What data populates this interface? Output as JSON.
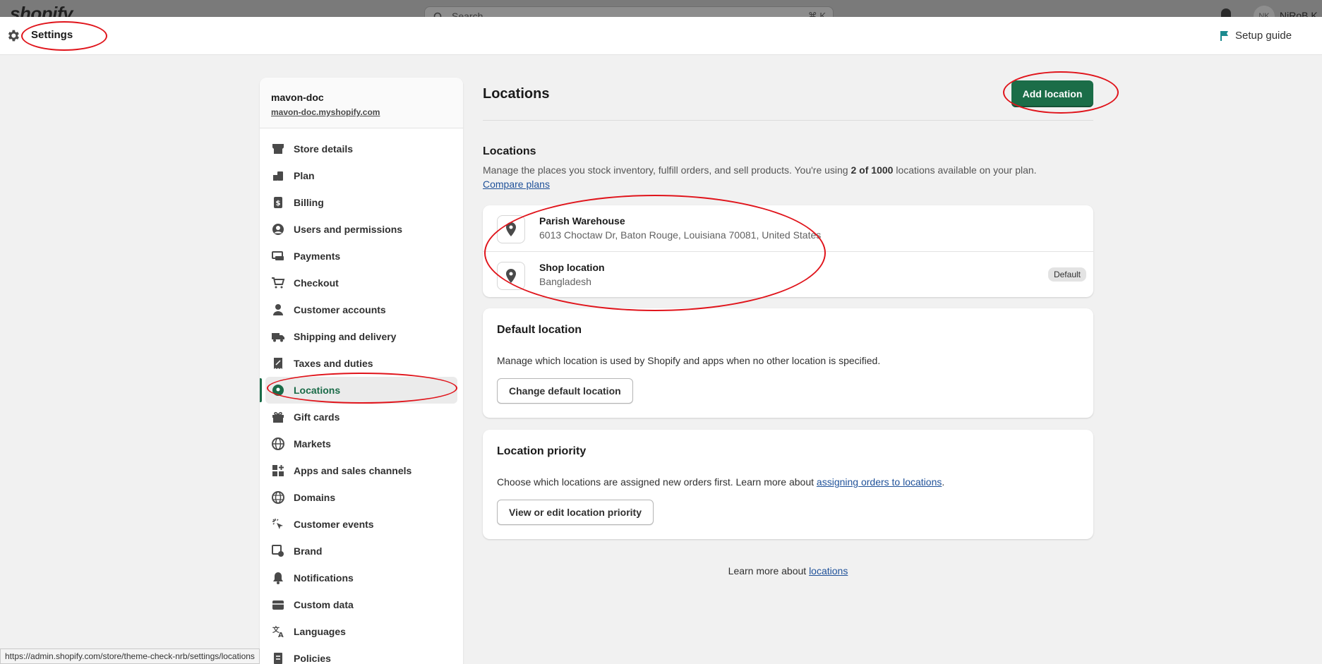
{
  "topbar": {
    "logo_text": "shopify",
    "search_placeholder": "Search",
    "search_shortcut": "⌘ K",
    "user_initials": "NK",
    "user_name": "NiRoB K"
  },
  "settings_bar": {
    "title": "Settings",
    "setup_guide_label": "Setup guide"
  },
  "store": {
    "name": "mavon-doc",
    "url": "mavon-doc.myshopify.com"
  },
  "sidebar": {
    "items": [
      {
        "label": "Store details",
        "icon": "store-icon",
        "active": false
      },
      {
        "label": "Plan",
        "icon": "plan-icon",
        "active": false
      },
      {
        "label": "Billing",
        "icon": "billing-icon",
        "active": false
      },
      {
        "label": "Users and permissions",
        "icon": "user-circle-icon",
        "active": false
      },
      {
        "label": "Payments",
        "icon": "payments-icon",
        "active": false
      },
      {
        "label": "Checkout",
        "icon": "cart-icon",
        "active": false
      },
      {
        "label": "Customer accounts",
        "icon": "person-icon",
        "active": false
      },
      {
        "label": "Shipping and delivery",
        "icon": "truck-icon",
        "active": false
      },
      {
        "label": "Taxes and duties",
        "icon": "tax-icon",
        "active": false
      },
      {
        "label": "Locations",
        "icon": "location-pin-icon",
        "active": true
      },
      {
        "label": "Gift cards",
        "icon": "gift-icon",
        "active": false
      },
      {
        "label": "Markets",
        "icon": "globe-icon",
        "active": false
      },
      {
        "label": "Apps and sales channels",
        "icon": "apps-icon",
        "active": false
      },
      {
        "label": "Domains",
        "icon": "domains-globe-icon",
        "active": false
      },
      {
        "label": "Customer events",
        "icon": "cursor-click-icon",
        "active": false
      },
      {
        "label": "Brand",
        "icon": "brand-icon",
        "active": false
      },
      {
        "label": "Notifications",
        "icon": "bell-icon",
        "active": false
      },
      {
        "label": "Custom data",
        "icon": "database-icon",
        "active": false
      },
      {
        "label": "Languages",
        "icon": "translate-icon",
        "active": false
      },
      {
        "label": "Policies",
        "icon": "policy-icon",
        "active": false
      }
    ]
  },
  "main": {
    "page_title": "Locations",
    "add_button": "Add location",
    "section_title": "Locations",
    "desc_part1": "Manage the places you stock inventory, fulfill orders, and sell products. You're using ",
    "desc_count": "2 of 1000",
    "desc_part2": " locations available on your plan. ",
    "compare_plans": "Compare plans",
    "locations": [
      {
        "name": "Parish Warehouse",
        "address": "6013 Choctaw Dr, Baton Rouge, Louisiana 70081, United States",
        "badge": ""
      },
      {
        "name": "Shop location",
        "address": "Bangladesh",
        "badge": "Default"
      }
    ],
    "default_card": {
      "title": "Default location",
      "text": "Manage which location is used by Shopify and apps when no other location is specified.",
      "button": "Change default location"
    },
    "priority_card": {
      "title": "Location priority",
      "text_before": "Choose which locations are assigned new orders first. Learn more about ",
      "link": "assigning orders to locations",
      "text_after": ".",
      "button": "View or edit location priority"
    },
    "learn_more_text": "Learn more about ",
    "learn_more_link": "locations"
  },
  "status_bar_url": "https://admin.shopify.com/store/theme-check-nrb/settings/locations",
  "colors": {
    "accent_green": "#1b6d48",
    "annotation_red": "#e0141b",
    "link_blue": "#1f5199"
  }
}
